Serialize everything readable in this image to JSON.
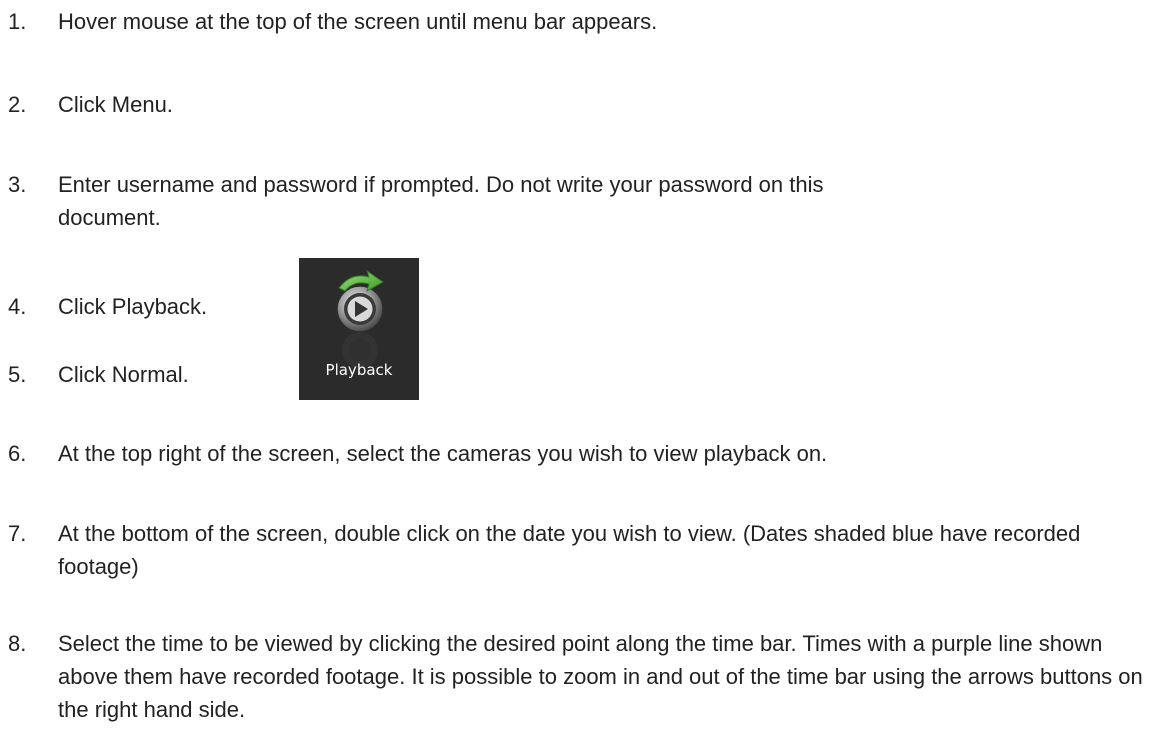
{
  "steps": [
    {
      "number": "1.",
      "text": "Hover mouse at the top of the screen until menu bar appears."
    },
    {
      "number": "2.",
      "text": "Click Menu."
    },
    {
      "number": "3.",
      "text": "Enter username and password if prompted. Do not write your password on this document."
    },
    {
      "number": "4.",
      "text": "Click Playback."
    },
    {
      "number": "5.",
      "text": "Click Normal."
    },
    {
      "number": "6.",
      "text": "At the top right of the screen, select the cameras you wish to view playback on."
    },
    {
      "number": "7.",
      "text": "At the bottom of the screen, double click on the date you wish to view. (Dates shaded blue have recorded footage)"
    },
    {
      "number": "8.",
      "text": "Select the time to be viewed by clicking the desired point along the time bar. Times with a purple line shown above them have recorded footage. It is possible to zoom in and out of the time bar using the arrows buttons on the right hand side."
    }
  ],
  "playback_tile": {
    "label": "Playback",
    "icon": "playback-icon",
    "background": "#2b2b2b",
    "arrow_color": "#4caf3a"
  }
}
